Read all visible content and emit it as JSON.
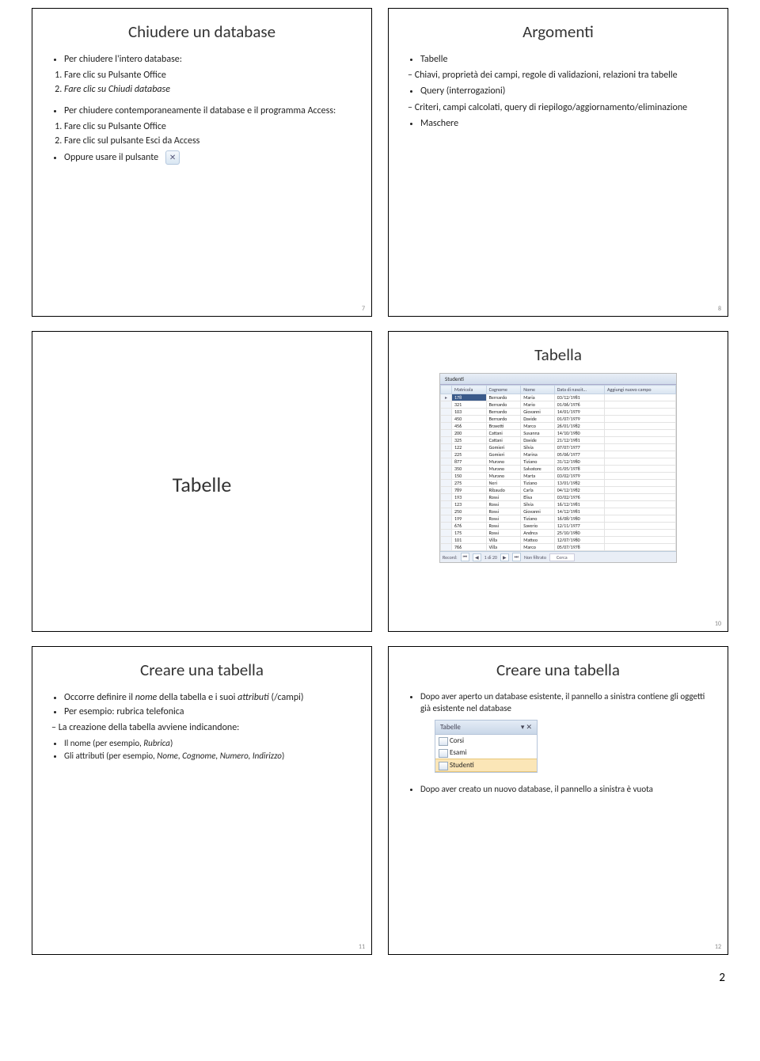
{
  "slides": {
    "s7": {
      "title": "Chiudere un database",
      "intro": "Per chiudere l'intero database:",
      "step1": "Fare clic su Pulsante Office",
      "step2": "Fare clic su Chiudi database",
      "intro2": "Per chiudere contemporaneamente il database e il programma Access:",
      "b1": "Fare clic su Pulsante Office",
      "b2": "Fare clic sul pulsante Esci da Access",
      "b3": "Oppure usare il pulsante",
      "pagenum": "7"
    },
    "s8": {
      "title": "Argomenti",
      "i1": "Tabelle",
      "i1a": "Chiavi, proprietà dei campi, regole di validazioni, relazioni tra tabelle",
      "i2": "Query (interrogazioni)",
      "i2a": "Criteri, campi calcolati, query di riepilogo/aggiornamento/eliminazione",
      "i3": "Maschere",
      "pagenum": "8"
    },
    "s9": {
      "title": "Tabelle"
    },
    "s10": {
      "title": "Tabella",
      "pagenum": "10",
      "tab_label": "Studenti",
      "headers": [
        "Matricola",
        "Cognome",
        "Nome",
        "Data di nascit…",
        "Aggiungi nuovo campo"
      ],
      "recbar": {
        "label": "Record:",
        "pos": "1 di 20",
        "filter": "Non filtrato",
        "search": "Cerca"
      }
    },
    "s11": {
      "title": "Creare una tabella",
      "b1_pre": "Occorre definire il ",
      "b1_em1": "nome",
      "b1_mid": " della tabella e i suoi ",
      "b1_em2": "attributi",
      "b1_post": " (/campi)",
      "b2": "Per esempio: rubrica telefonica",
      "b2a": "La creazione della tabella avviene indicandone:",
      "b2a1_pre": "Il nome (per esempio, ",
      "b2a1_em": "Rubrica",
      "b2a1_post": ")",
      "b2a2_pre": "Gli attributi (per esempio, ",
      "b2a2_em": "Nome, Cognome, Numero, Indirizzo",
      "b2a2_post": ")",
      "pagenum": "11"
    },
    "s12": {
      "title": "Creare una tabella",
      "b1": "Dopo aver aperto un database esistente, il pannello a sinistra contiene gli oggetti già esistente nel database",
      "nav": {
        "head": "Tabelle",
        "items": [
          "Corsi",
          "Esami",
          "Studenti"
        ]
      },
      "b2": "Dopo aver creato un nuovo database, il pannello a sinistra è vuota",
      "pagenum": "12"
    }
  },
  "chart_data": {
    "type": "table",
    "title": "Studenti",
    "columns": [
      "Matricola",
      "Cognome",
      "Nome",
      "Data di nascita"
    ],
    "rows": [
      [
        "178",
        "Bernardo",
        "Maria",
        "03/12/1981"
      ],
      [
        "321",
        "Bernardo",
        "Mario",
        "01/06/1976"
      ],
      [
        "103",
        "Bernardo",
        "Giovanni",
        "14/01/1979"
      ],
      [
        "450",
        "Bernardo",
        "Davide",
        "01/07/1979"
      ],
      [
        "456",
        "Bravetti",
        "Marco",
        "26/01/1982"
      ],
      [
        "200",
        "Cattani",
        "Susanna",
        "14/10/1980"
      ],
      [
        "325",
        "Cattani",
        "Davide",
        "21/12/1981"
      ],
      [
        "122",
        "Gomieri",
        "Silvia",
        "07/07/1977"
      ],
      [
        "225",
        "Gomieri",
        "Marina",
        "05/06/1977"
      ],
      [
        "877",
        "Murano",
        "Tiziano",
        "31/12/1980"
      ],
      [
        "350",
        "Murano",
        "Salvatore",
        "01/05/1978"
      ],
      [
        "150",
        "Murano",
        "Marta",
        "03/02/1979"
      ],
      [
        "275",
        "Neri",
        "Tiziano",
        "13/01/1982"
      ],
      [
        "789",
        "Ribaudo",
        "Carla",
        "04/12/1982"
      ],
      [
        "193",
        "Rossi",
        "Elisa",
        "03/02/1976"
      ],
      [
        "123",
        "Rossi",
        "Silvia",
        "16/12/1981"
      ],
      [
        "250",
        "Rossi",
        "Giovanni",
        "14/12/1981"
      ],
      [
        "199",
        "Rossi",
        "Tiziano",
        "16/08/1980"
      ],
      [
        "676",
        "Rossi",
        "Saverio",
        "12/11/1977"
      ],
      [
        "175",
        "Rossi",
        "Andrea",
        "25/10/1980"
      ],
      [
        "101",
        "Villa",
        "Matteo",
        "12/07/1980"
      ],
      [
        "766",
        "Villa",
        "Marco",
        "05/07/1978"
      ]
    ]
  },
  "page_footer": "2"
}
